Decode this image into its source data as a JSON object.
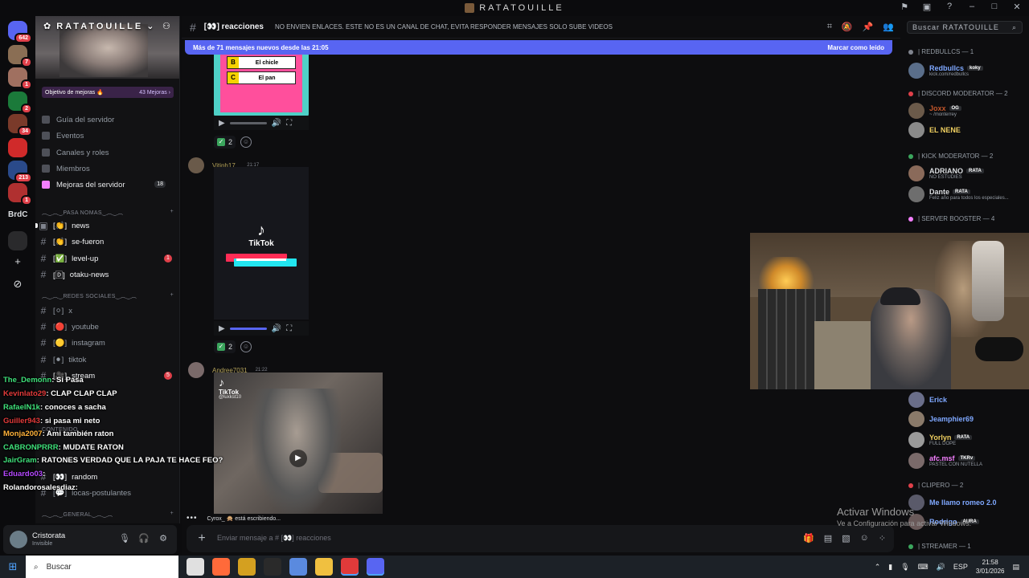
{
  "window": {
    "title": "RATATOUILLE"
  },
  "rail": {
    "servers": [
      {
        "name": "discord-home",
        "badge": "642",
        "color": "#5865f2"
      },
      {
        "name": "server-1",
        "badge": "7",
        "color": "#8a6e54"
      },
      {
        "name": "server-2",
        "badge": "1",
        "color": "#a07060"
      },
      {
        "name": "server-3",
        "badge": "2",
        "color": "#1b7a3a"
      },
      {
        "name": "server-4",
        "badge": "34",
        "color": "#7a3a2a"
      },
      {
        "name": "server-5",
        "badge": "",
        "color": "#d02a2a"
      },
      {
        "name": "server-6",
        "badge": "213",
        "color": "#2a4a8a"
      },
      {
        "name": "server-7",
        "badge": "1",
        "color": "#b03030"
      }
    ],
    "folder_label": "BrdC"
  },
  "sidebar": {
    "server_name": "RATATOUILLE",
    "boost": {
      "label": "Objetivo de mejoras 🔥",
      "count": "43 Mejoras ›"
    },
    "nav": [
      {
        "label": "Guía del servidor"
      },
      {
        "label": "Eventos"
      },
      {
        "label": "Canales y roles"
      },
      {
        "label": "Miembros"
      },
      {
        "label": "Mejoras del servidor",
        "count": "18"
      }
    ],
    "categories": {
      "pasa_nomas": "︵‿︵‿PASA NOMAS‿︵‿︵",
      "redes": "︵‿︵‿REDES SOCIALES‿︵‿︵",
      "general": "︵‿︵‿GENERAL‿︵‿︵",
      "contenido": "CONTENIDO"
    },
    "channels": [
      {
        "label": "news",
        "prefix": "[👏]"
      },
      {
        "label": "se-fueron",
        "prefix": "[👏]"
      },
      {
        "label": "level-up",
        "prefix": "[✅]",
        "mention": "1"
      },
      {
        "label": "otaku-news",
        "prefix": "[🄳]"
      },
      {
        "label": "x",
        "prefix": "[⚪]"
      },
      {
        "label": "youtube",
        "prefix": "[🔴]"
      },
      {
        "label": "instagram",
        "prefix": "[🟡]"
      },
      {
        "label": "tiktok",
        "prefix": "[⚫]"
      },
      {
        "label": "stream",
        "prefix": "[🎥]",
        "mention": "5"
      },
      {
        "label": "random",
        "prefix": "[👀]"
      },
      {
        "label": "locas-postulantes",
        "prefix": "[💬]"
      }
    ],
    "user": {
      "name": "Cristorata",
      "status": "Invisible"
    }
  },
  "chat_overlay": [
    {
      "user": "The_Demonn",
      "color": "#3fe07a",
      "text": ": Si Pasa"
    },
    {
      "user": "Kevinlato29",
      "color": "#e23a3a",
      "text": ": CLAP CLAP CLAP"
    },
    {
      "user": "RafaelN1k",
      "color": "#3fe07a",
      "text": ": conoces a sacha"
    },
    {
      "user": "Guiller943",
      "color": "#e23a3a",
      "text": ": si pasa mi neto"
    },
    {
      "user": "Monja2007",
      "color": "#ffb23a",
      "text": ": Ami también raton"
    },
    {
      "user": "CABRONPRRR",
      "color": "#3fe07a",
      "text": ": MUDATE RATON"
    },
    {
      "user": "JairGram",
      "color": "#3fe07a",
      "text": ": RATONES VERDAD QUE LA PAJA TE HACE FEO?"
    },
    {
      "user": "Eduardo03",
      "color": "#b548ff",
      "text": ":"
    },
    {
      "user": "Rolandorosalesdiaz",
      "color": "#ffffff",
      "text": ":"
    }
  ],
  "main": {
    "channel_name": "[👀] reacciones",
    "topic": "NO ENVIEN ENLACES. ESTE NO ES UN CANAL DE CHAT, EVITA RESPONDER MENSAJES SOLO SUBE VIDEOS",
    "new_messages": "Más de 71 mensajes nuevos desde las 21:05",
    "mark_read": "Marcar como leído",
    "quiz": [
      {
        "letter": "B",
        "answer": "El chicle"
      },
      {
        "letter": "C",
        "answer": "El pan"
      }
    ],
    "messages": [
      {
        "author": "Vitinh17_",
        "time": "21:17",
        "author_color": "#b5a35a",
        "tiktok_brand": "TikTok",
        "reaction_count": "2"
      },
      {
        "author": "Andree7031",
        "time": "21:22",
        "author_color": "#b5a35a",
        "tiktok_brand": "TikTok",
        "tiktok_handle": "@luxkst10",
        "reaction_count": "2"
      }
    ],
    "first_reaction_count": "2",
    "typing": "Cyrox_ 🙊 está escribiendo...",
    "composer_placeholder": "Enviar mensaje a # [👀] reacciones"
  },
  "members": {
    "search_placeholder": "Buscar RATATOUILLE",
    "groups": [
      {
        "role": "| REDBULLCS — 1",
        "color": "#80848e"
      },
      {
        "role": "| DISCORD MODERATOR — 2",
        "color": "#e0404a"
      },
      {
        "role": "| KICK MODERATOR — 2",
        "color": "#3ba55d"
      },
      {
        "role": "| SERVER BOOSTER — 4",
        "color": "#f47fff"
      },
      {
        "role": "| CLIPERO — 2",
        "color": "#e0404a"
      },
      {
        "role": "| STREAMER — 1",
        "color": "#3ba55d"
      }
    ],
    "list": [
      {
        "name": "Redbullcs",
        "tag": "koky",
        "sub": "kick.com/redbullcs",
        "color": "#7fa8ff",
        "av": "#5a6e8a"
      },
      {
        "name": "Joxx",
        "tag": "OG",
        "sub": "~ /monterrey",
        "color": "#c0552a",
        "av": "#6b5a4a"
      },
      {
        "name": "EL NENE",
        "tag": "",
        "sub": "",
        "color": "#f0d060",
        "av": "#8a8a8a"
      },
      {
        "name": "ADRIANO",
        "tag": "RATA",
        "sub": "NO ESTUDIES",
        "color": "#dbdee1",
        "av": "#8a6a5a"
      },
      {
        "name": "Dante",
        "tag": "RATA",
        "sub": "Feliz año para todos los especiales...",
        "color": "#dbdee1",
        "av": "#6e6e6e"
      },
      {
        "name": "Erick",
        "tag": "",
        "sub": "",
        "color": "#7fa8ff",
        "av": "#6a6e8a"
      },
      {
        "name": "Jeamphier69",
        "tag": "",
        "sub": "",
        "color": "#7fa8ff",
        "av": "#8a7a6a"
      },
      {
        "name": "Yorlyn",
        "tag": "RATA",
        "sub": "FULL DOPE",
        "color": "#f0d060",
        "av": "#9a9a9a"
      },
      {
        "name": "afc.msf",
        "tag": "TKRv",
        "sub": "PASTEL CON NUTELLA",
        "color": "#f47fff",
        "av": "#7a6a6a"
      },
      {
        "name": "Me llamo romeo 2.0",
        "tag": "",
        "sub": "",
        "color": "#7fa8ff",
        "av": "#5a5a6a"
      },
      {
        "name": "Rodrigo",
        "tag": "AURA",
        "sub": "",
        "color": "#7fa8ff",
        "av": "#6a5a5a"
      }
    ]
  },
  "watermark": {
    "line1": "Activar Windows",
    "line2": "Ve a Configuración para activar Windows."
  },
  "taskbar": {
    "search": "Buscar",
    "lang": "ESP",
    "time": "21:58",
    "date": "3/01/2026",
    "app_colors": [
      "#e0e0e0",
      "#ff6a3a",
      "#4fa3ff",
      "#d4a020",
      "#2a2a2a",
      "#5a8adf",
      "#f0c040",
      "#e03a3a",
      "#5865f2"
    ]
  }
}
